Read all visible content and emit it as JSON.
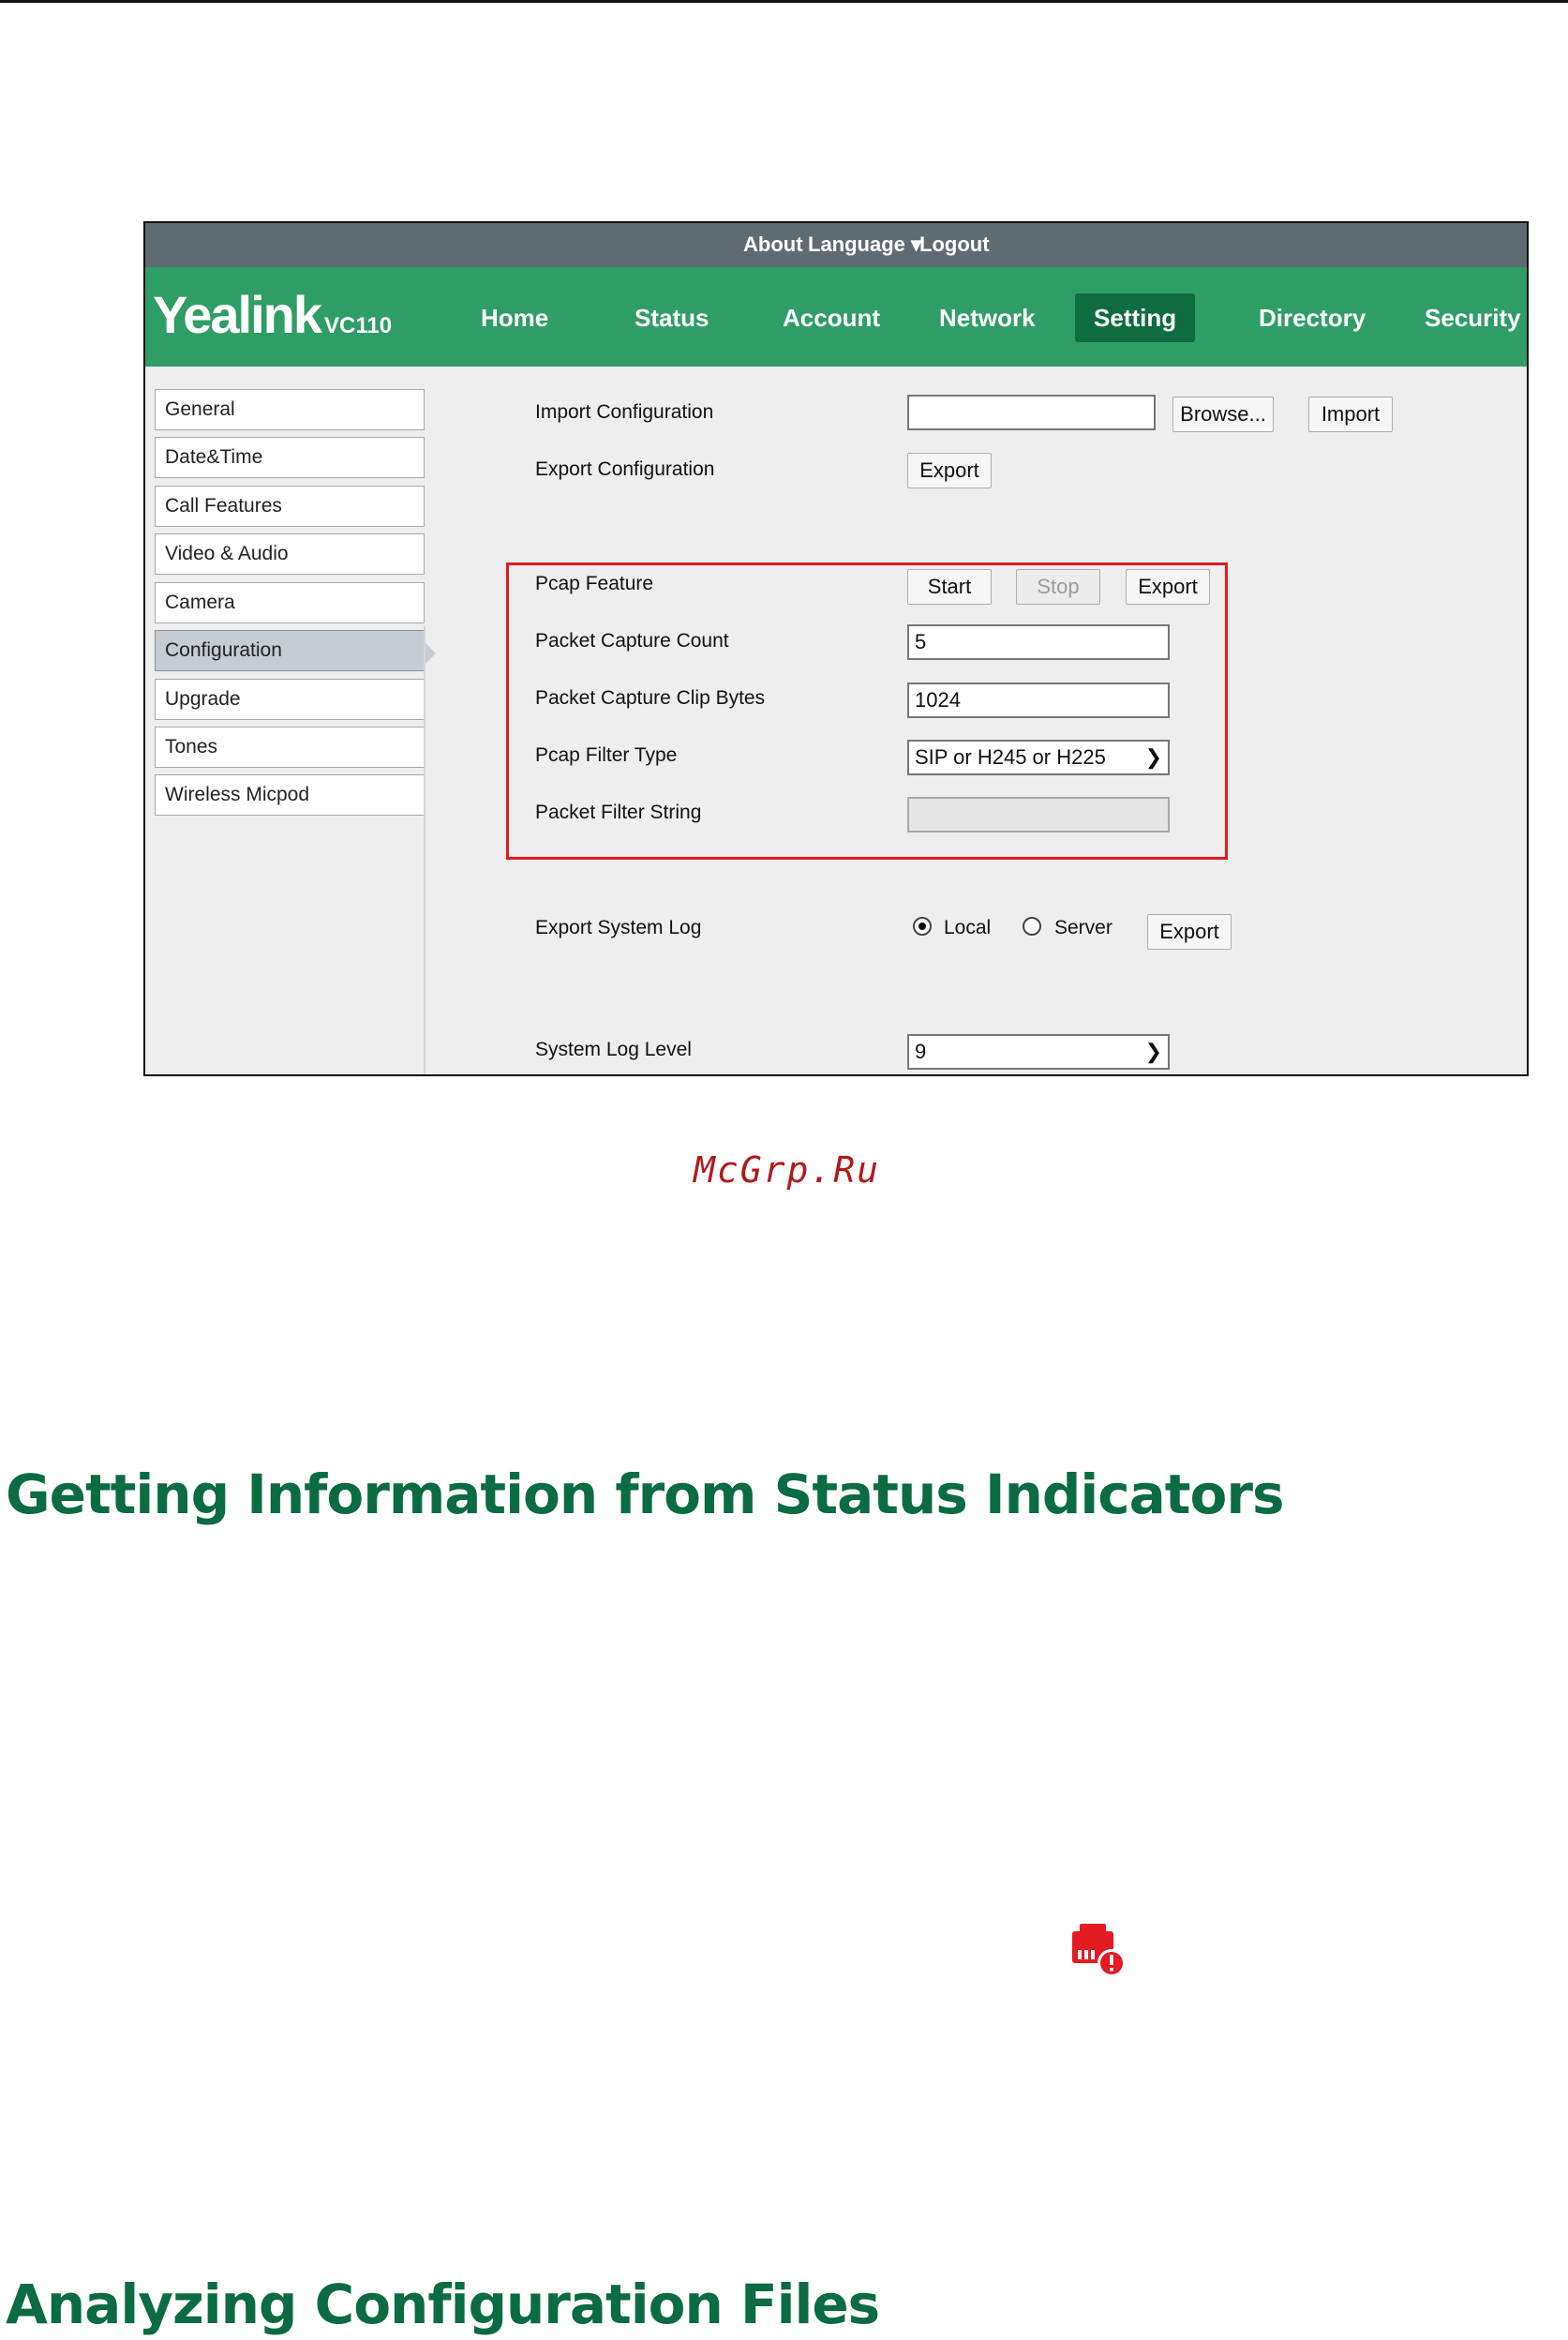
{
  "header": {
    "links": [
      "About",
      "Language ▾",
      "Logout"
    ]
  },
  "brand": {
    "name": "Yealink",
    "model": "VC110"
  },
  "nav": {
    "items": [
      "Home",
      "Status",
      "Account",
      "Network",
      "Setting",
      "Directory",
      "Security"
    ],
    "active": "Setting"
  },
  "sidebar": {
    "items": [
      "General",
      "Date&Time",
      "Call Features",
      "Video & Audio",
      "Camera",
      "Configuration",
      "Upgrade",
      "Tones",
      "Wireless Micpod"
    ],
    "active": "Configuration"
  },
  "config": {
    "import_label": "Import Configuration",
    "import_input_value": "",
    "browse_button": "Browse...",
    "import_button": "Import",
    "export_label": "Export Configuration",
    "export_button": "Export"
  },
  "pcap": {
    "feature_label": "Pcap Feature",
    "start_button": "Start",
    "stop_button": "Stop",
    "export_button": "Export",
    "count_label": "Packet Capture Count",
    "count_value": "5",
    "clip_label": "Packet Capture Clip Bytes",
    "clip_value": "1024",
    "filter_type_label": "Pcap Filter Type",
    "filter_type_value": "SIP or H245 or H225",
    "filter_string_label": "Packet Filter String",
    "filter_string_value": ""
  },
  "syslog": {
    "export_label": "Export System Log",
    "option_local": "Local",
    "option_server": "Server",
    "selected": "Local",
    "export_button": "Export",
    "level_label": "System Log Level",
    "level_value": "9"
  },
  "watermark": "McGrp.Ru",
  "headings": {
    "status_indicators": "Getting Information from Status Indicators",
    "config_files": "Analyzing Configuration Files"
  },
  "colors": {
    "brand_green": "#2f9d66",
    "active_green": "#0f6b40",
    "heading_green": "#0b6b43",
    "highlight_red": "#e11b22"
  },
  "icons": {
    "status": "network-error-icon"
  }
}
